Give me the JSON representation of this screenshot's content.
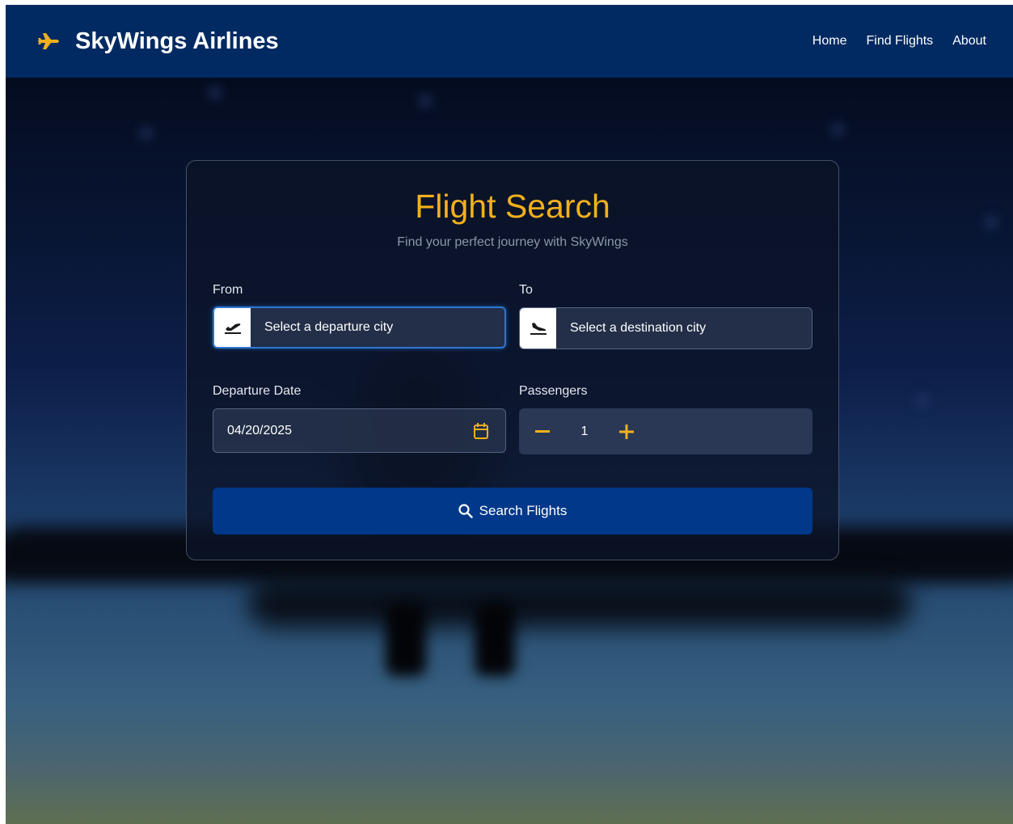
{
  "header": {
    "brand_title": "SkyWings Airlines",
    "nav": [
      "Home",
      "Find Flights",
      "About"
    ]
  },
  "form": {
    "title": "Flight Search",
    "subtitle": "Find your perfect journey with SkyWings",
    "from": {
      "label": "From",
      "placeholder": "Select a departure city"
    },
    "to": {
      "label": "To",
      "placeholder": "Select a destination city"
    },
    "date": {
      "label": "Departure Date",
      "value": "04/20/2025"
    },
    "passengers": {
      "label": "Passengers",
      "value": "1"
    },
    "search_label": "Search Flights"
  },
  "colors": {
    "accent": "#f2b01d",
    "header_bg": "#012a62",
    "button_bg": "#01388a",
    "focus": "#2b77d3"
  },
  "icons": [
    "plane-icon",
    "departure-icon",
    "arrival-icon",
    "calendar-icon",
    "minus-icon",
    "plus-icon",
    "search-icon"
  ]
}
